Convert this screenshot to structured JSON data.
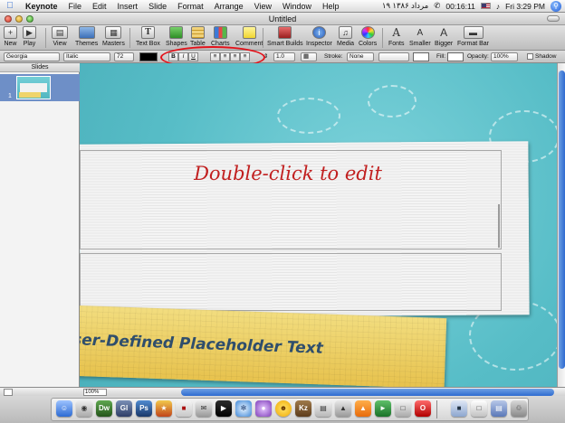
{
  "menubar": {
    "apple": "",
    "items": [
      "Keynote",
      "File",
      "Edit",
      "Insert",
      "Slide",
      "Format",
      "Arrange",
      "View",
      "Window",
      "Help"
    ],
    "persian_date": "۱۹ مرداد ۱۳۸۶",
    "clock": "00:16:11",
    "day_time": "Fri 3:29 PM"
  },
  "window": {
    "title": "Untitled"
  },
  "toolbar": {
    "new": "New",
    "play": "Play",
    "view": "View",
    "themes": "Themes",
    "masters": "Masters",
    "text_box": "Text Box",
    "shapes": "Shapes",
    "table": "Table",
    "charts": "Charts",
    "comment": "Comment",
    "smart_builds": "Smart Builds",
    "inspector": "Inspector",
    "media": "Media",
    "colors": "Colors",
    "fonts": "Fonts",
    "smaller": "Smaller",
    "bigger": "Bigger",
    "format_bar": "Format Bar"
  },
  "formatbar": {
    "font": "Georgia",
    "style": "Italic",
    "size": "72",
    "bold": "B",
    "italic": "I",
    "underline": "U",
    "line_spacing_value": "1.0",
    "stroke_label": "Stroke:",
    "stroke_value": "None",
    "fill_label": "Fill:",
    "opacity_label": "Opacity:",
    "opacity_value": "100%",
    "shadow_label": "Shadow",
    "text_color": "#000000",
    "highlight_color": "#e3121a"
  },
  "slides_pane": {
    "header": "Slides",
    "slide_number": "1"
  },
  "canvas": {
    "title_placeholder": "Double-click to edit",
    "yellow_placeholder": "ser-Defined Placeholder Text"
  },
  "statusbar": {
    "zoom": "100%"
  }
}
